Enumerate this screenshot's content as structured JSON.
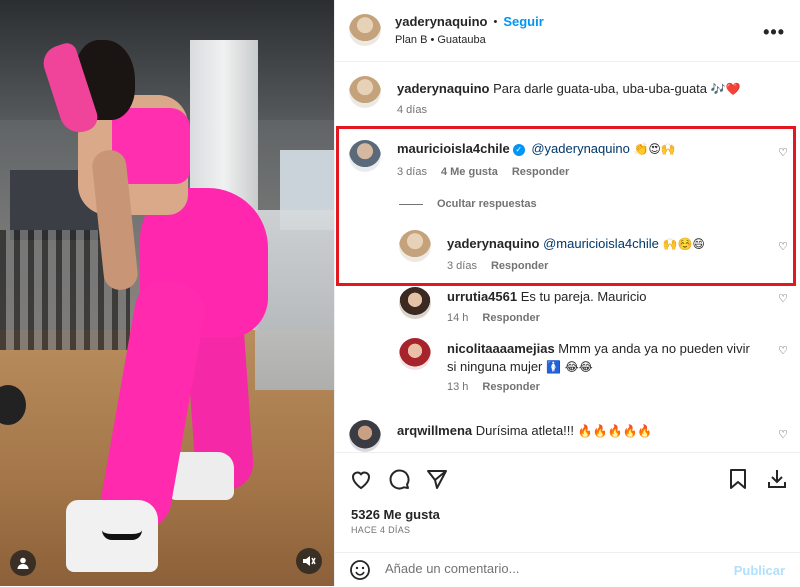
{
  "post": {
    "author": "yaderynaquino",
    "dot": "•",
    "follow_label": "Seguir",
    "location": "Plan B • Guatauba",
    "more_icon": "more-options-icon",
    "caption": {
      "user": "yaderynaquino",
      "text": "Para darle guata-uba, uba-uba-guata",
      "emoji": "🎶❤️",
      "time": "4 días"
    }
  },
  "comments": [
    {
      "user": "mauricioisla4chile",
      "verified": true,
      "text": "@yaderynaquino",
      "emoji": "👏😍🙌",
      "time": "3 días",
      "likes": "4 Me gusta",
      "reply_label": "Responder",
      "hide_replies_label": "Ocultar respuestas",
      "replies": [
        {
          "user": "yaderynaquino",
          "text": "@mauricioisla4chile",
          "emoji": "🙌☺️😄",
          "time": "3 días",
          "reply_label": "Responder"
        }
      ]
    },
    {
      "user": "urrutia4561",
      "text": "Es tu pareja. Mauricio",
      "time": "14 h",
      "reply_label": "Responder"
    },
    {
      "user": "nicolitaaaamejias",
      "text": "Mmm ya anda ya no pueden vivir",
      "text2": "si ninguna mujer",
      "emoji": "🚺 😂😂",
      "time": "13 h",
      "reply_label": "Responder"
    },
    {
      "user": "arqwillmena",
      "text": "Durísima atleta!!!",
      "emoji": "🔥🔥🔥🔥🔥"
    }
  ],
  "actions": {
    "likes": "5326 Me gusta",
    "ago": "HACE 4 DÍAS"
  },
  "composer": {
    "placeholder": "Añade un comentario...",
    "publish_label": "Publicar"
  },
  "colors": {
    "accent": "#0095f6",
    "highlight": "#e2171f",
    "legging": "#ff2aae"
  }
}
